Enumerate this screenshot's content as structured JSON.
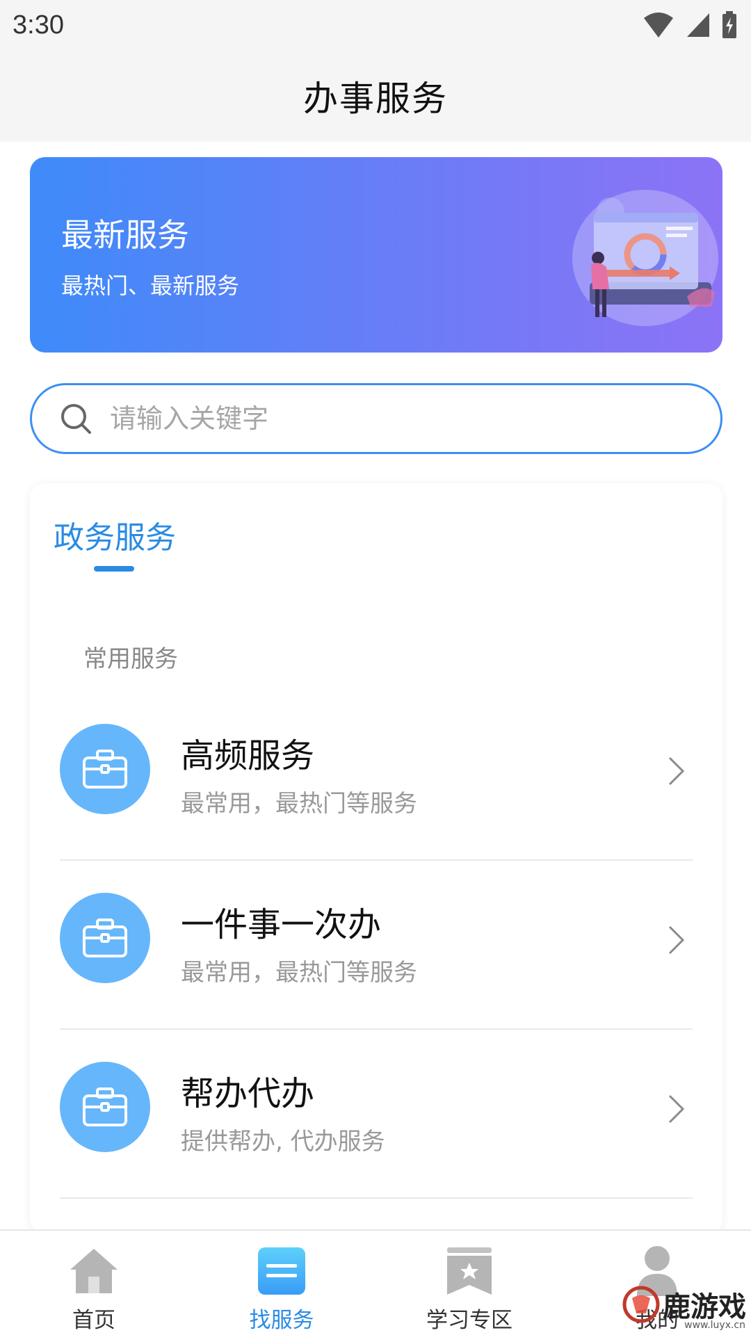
{
  "status_bar": {
    "time": "3:30"
  },
  "header": {
    "title": "办事服务"
  },
  "banner": {
    "title": "最新服务",
    "subtitle": "最热门、最新服务"
  },
  "search": {
    "placeholder": "请输入关键字"
  },
  "card": {
    "tab_title": "政务服务",
    "section_label": "常用服务",
    "items": [
      {
        "title": "高频服务",
        "description": "最常用，最热门等服务"
      },
      {
        "title": "一件事一次办",
        "description": "最常用，最热门等服务"
      },
      {
        "title": "帮办代办",
        "description": "提供帮办, 代办服务"
      }
    ]
  },
  "bottom_nav": {
    "items": [
      {
        "label": "首页",
        "icon": "home-icon",
        "active": false
      },
      {
        "label": "找服务",
        "icon": "service-list-icon",
        "active": true
      },
      {
        "label": "学习专区",
        "icon": "study-icon",
        "active": false
      },
      {
        "label": "我的",
        "icon": "user-icon",
        "active": false
      }
    ]
  },
  "watermark": {
    "text": "鹿游戏",
    "url": "www.luyx.cn"
  },
  "colors": {
    "accent": "#2a8be4",
    "search_border": "#3c8ef3",
    "icon_circle": "#66b6fb",
    "banner_start": "#3e8bf9",
    "banner_end": "#8c73f6"
  }
}
